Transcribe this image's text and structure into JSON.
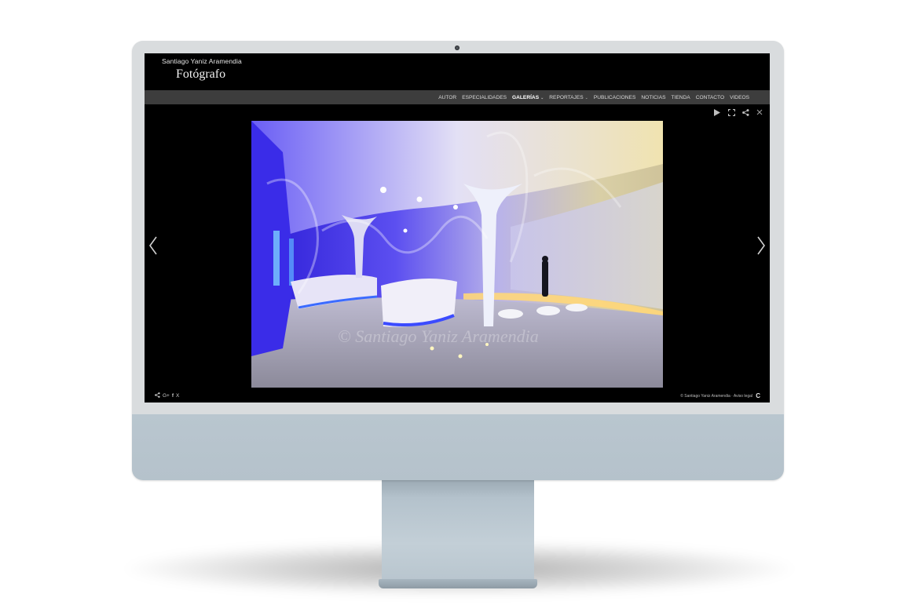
{
  "site": {
    "name": "Santiago Yaniz Aramendia",
    "role": "Fotógrafo"
  },
  "nav": {
    "items": [
      {
        "label": "AUTOR",
        "active": false,
        "has_dropdown": false
      },
      {
        "label": "ESPECIALIDADES",
        "active": false,
        "has_dropdown": false
      },
      {
        "label": "GALERÍAS",
        "active": true,
        "has_dropdown": true
      },
      {
        "label": "REPORTAJES",
        "active": false,
        "has_dropdown": true
      },
      {
        "label": "PUBLICACIONES",
        "active": false,
        "has_dropdown": false
      },
      {
        "label": "NOTICIAS",
        "active": false,
        "has_dropdown": false
      },
      {
        "label": "TIENDA",
        "active": false,
        "has_dropdown": false
      },
      {
        "label": "CONTACTO",
        "active": false,
        "has_dropdown": false
      },
      {
        "label": "VIDEOS",
        "active": false,
        "has_dropdown": false
      }
    ]
  },
  "lightbox": {
    "tools": [
      "play-icon",
      "fullscreen-icon",
      "share-icon",
      "close-icon"
    ],
    "arrows": [
      "chevron-left-icon",
      "chevron-right-icon"
    ],
    "watermark": "© Santiago Yaniz Aramendia"
  },
  "footer": {
    "share": {
      "google": "G+",
      "facebook": "f",
      "x": "X"
    },
    "copyright": "© Santiago Yaniz Aramendia · Aviso legal",
    "brand_mark": "C"
  },
  "colors": {
    "header_bg": "#000000",
    "navbar_bg": "#3d3d3d",
    "accent_blue": "#3b2cff",
    "warm_light": "#f2c66a"
  }
}
